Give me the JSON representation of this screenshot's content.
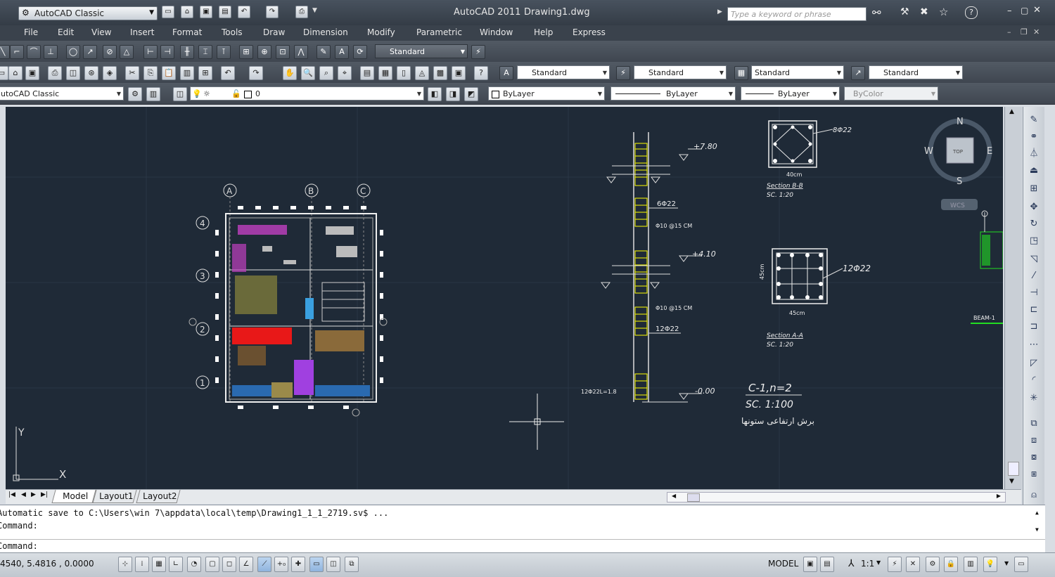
{
  "title_bar": {
    "workspace": "AutoCAD Classic",
    "app_title": "AutoCAD 2011",
    "file_name": "Drawing1.dwg",
    "search_placeholder": "Type a keyword or phrase"
  },
  "menu": [
    "File",
    "Edit",
    "View",
    "Insert",
    "Format",
    "Tools",
    "Draw",
    "Dimension",
    "Modify",
    "Parametric",
    "Window",
    "Help",
    "Express"
  ],
  "toolbars": {
    "dim_style": "Standard",
    "text_style": "Standard",
    "dimension_style": "Standard",
    "table_style": "Standard",
    "multileader_style": "Standard",
    "workspace_combo": "utoCAD Classic",
    "layer_combo": "0",
    "color_combo": "ByLayer",
    "linetype_combo": "ByLayer",
    "lineweight_combo": "ByLayer",
    "plotstyle_combo": "ByColor"
  },
  "viewcube": {
    "north": "N",
    "south": "S",
    "east": "E",
    "west": "W",
    "top": "TOP",
    "wcs": "WCS"
  },
  "drawing": {
    "grid_labels_cols": [
      "A",
      "B",
      "C"
    ],
    "grid_labels_rows": [
      "4",
      "3",
      "2",
      "1"
    ],
    "level_top": "+7.80",
    "level_mid": "+4.10",
    "level_bottom": "-0.00",
    "rebar_a": "6Φ22",
    "rebar_b": "12Φ22",
    "stirrup_a": "Φ10 @15 CM",
    "stirrup_b": "Φ10 @15 CM",
    "section_b_label": "8Φ22",
    "section_b_width": "40cm",
    "section_b_title": "Section B-B",
    "section_b_scale": "SC. 1:20",
    "section_a_label": "12Φ22",
    "section_a_width": "45cm",
    "section_a_height": "45cm",
    "section_a_title": "Section A-A",
    "section_a_scale": "SC. 1:20",
    "column_label": "12Φ22L=1.8",
    "column_title": "C-1,n=2",
    "column_scale": "SC. 1:100",
    "column_note": "برش ارتفاعی ستونها",
    "beam_label": "BEAM-1",
    "ucs_x": "X",
    "ucs_y": "Y"
  },
  "tabs": [
    "Model",
    "Layout1",
    "Layout2"
  ],
  "command": {
    "line1": "Automatic save to C:\\Users\\win 7\\appdata\\local\\temp\\Drawing1_1_1_2719.sv$ ...",
    "line2": "Command:",
    "prompt": "Command:"
  },
  "status": {
    "coordinates": "4540, 5.4816 , 0.0000",
    "model": "MODEL",
    "annotation_scale": "1:1"
  },
  "colors": {
    "canvas": "#1f2a37",
    "rebar": "#ffff00",
    "green": "#22dd22",
    "furniture_red": "#e81818",
    "furniture_magenta": "#c040c0"
  }
}
